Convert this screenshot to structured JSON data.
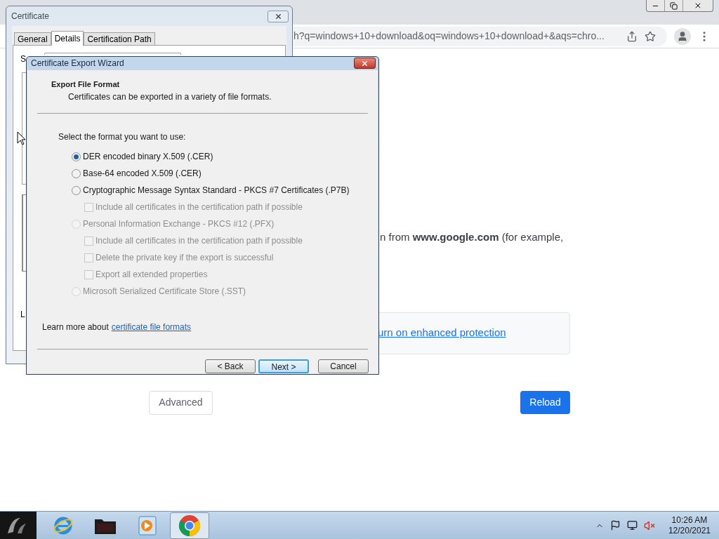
{
  "browser": {
    "address_text": "h?q=windows+10+download&oq=windows+10+download+&aqs=chro..."
  },
  "page": {
    "message": "n from **www.google.com** (for example,",
    "protection_link": "urn on enhanced protection",
    "advanced_button": "Advanced",
    "reload_button": "Reload"
  },
  "certificate_window": {
    "title": "Certificate",
    "tabs": [
      {
        "label": "General",
        "selected": false
      },
      {
        "label": "Details",
        "selected": true
      },
      {
        "label": "Certification Path",
        "selected": false
      }
    ],
    "label_top": "S",
    "label_bottom": "L"
  },
  "wizard": {
    "title": "Certificate Export Wizard",
    "header_title": "Export File Format",
    "header_subtitle": "Certificates can be exported in a variety of file formats.",
    "prompt": "Select the format you want to use:",
    "options": [
      {
        "label": "DER encoded binary X.509 (.CER)",
        "selected": true,
        "disabled": false
      },
      {
        "label": "Base-64 encoded X.509 (.CER)",
        "selected": false,
        "disabled": false
      },
      {
        "label": "Cryptographic Message Syntax Standard - PKCS #7 Certificates (.P7B)",
        "selected": false,
        "disabled": false,
        "children": [
          {
            "label": "Include all certificates in the certification path if possible",
            "checked": false,
            "disabled": true
          }
        ]
      },
      {
        "label": "Personal Information Exchange - PKCS #12 (.PFX)",
        "selected": false,
        "disabled": true,
        "children": [
          {
            "label": "Include all certificates in the certification path if possible",
            "checked": false,
            "disabled": true
          },
          {
            "label": "Delete the private key if the export is successful",
            "checked": false,
            "disabled": true
          },
          {
            "label": "Export all extended properties",
            "checked": false,
            "disabled": true
          }
        ]
      },
      {
        "label": "Microsoft Serialized Certificate Store (.SST)",
        "selected": false,
        "disabled": true
      }
    ],
    "learn_more_prefix": "Learn more about",
    "learn_more_link": "certificate file formats",
    "buttons": [
      {
        "label": "< Back",
        "default": false
      },
      {
        "label": "Next >",
        "default": true
      },
      {
        "label": "Cancel",
        "default": false
      }
    ]
  },
  "taskbar": {
    "apps": [
      {
        "kind": "browser-e",
        "selected": false
      },
      {
        "kind": "folder",
        "selected": false
      },
      {
        "kind": "media",
        "selected": false
      },
      {
        "kind": "chrome",
        "selected": true
      }
    ],
    "time": "10:26 AM",
    "date": "12/20/2021"
  }
}
